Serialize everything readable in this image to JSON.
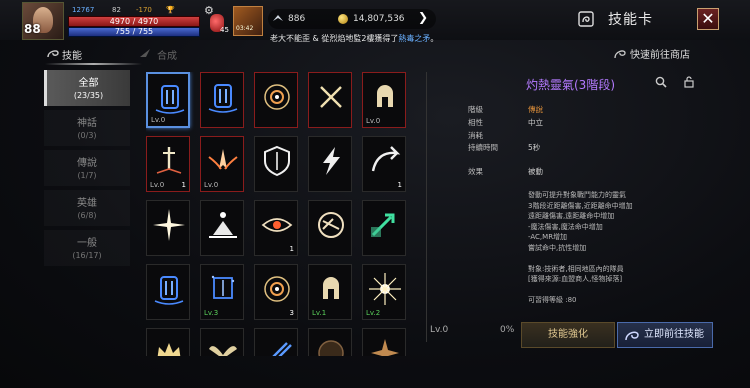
{
  "player": {
    "level": "88",
    "power": "12767",
    "stat2": "82",
    "stat3": "-170",
    "hp": "4970 / 4970",
    "mp": "755 / 755",
    "potion_count": "45",
    "buff_time": "03:42"
  },
  "currency": {
    "wings": "886",
    "gold": "14,807,536"
  },
  "window": {
    "title": "技能卡",
    "close": "✕",
    "icon": "skill-card-icon"
  },
  "marquee": {
    "text": "老大不能歪 & 從烈焰地監2樓獲得了",
    "item": "熱毒之矛",
    "end": "。"
  },
  "tabs": {
    "skill": "技能",
    "combine": "合成",
    "shop": "快速前往商店"
  },
  "categories": [
    {
      "name": "全部",
      "count": "(23/35)",
      "active": true
    },
    {
      "name": "神話",
      "count": "(0/3)"
    },
    {
      "name": "傳說",
      "count": "(1/7)"
    },
    {
      "name": "英雄",
      "count": "(6/8)"
    },
    {
      "name": "一般",
      "count": "(16/17)"
    }
  ],
  "grid": [
    {
      "icon": "blue-pillar-icon",
      "lv": "Lv.0",
      "num": "",
      "border": "sel"
    },
    {
      "icon": "blue-pillar-icon",
      "lv": "",
      "num": "",
      "border": "red"
    },
    {
      "icon": "target-icon",
      "lv": "",
      "num": "",
      "border": "red"
    },
    {
      "icon": "crossed-swords-icon",
      "lv": "",
      "num": "",
      "border": "red"
    },
    {
      "icon": "spartan-helmet-icon",
      "lv": "Lv.0",
      "num": "",
      "border": "red"
    },
    {
      "icon": "sword-ground-icon",
      "lv": "Lv.0",
      "num": "1",
      "border": "red"
    },
    {
      "icon": "winged-swords-icon",
      "lv": "Lv.0",
      "num": "",
      "border": "red"
    },
    {
      "icon": "shield-icon",
      "lv": "",
      "num": "",
      "border": ""
    },
    {
      "icon": "lightning-icon",
      "lv": "",
      "num": "",
      "border": ""
    },
    {
      "icon": "swoosh-icon",
      "lv": "",
      "num": "1",
      "border": ""
    },
    {
      "icon": "burst-icon",
      "lv": "",
      "num": "",
      "border": ""
    },
    {
      "icon": "fulcrum-icon",
      "lv": "",
      "num": "",
      "border": ""
    },
    {
      "icon": "eye-icon",
      "lv": "",
      "num": "1",
      "border": ""
    },
    {
      "icon": "claw-ring-icon",
      "lv": "",
      "num": "",
      "border": ""
    },
    {
      "icon": "green-arrow-icon",
      "lv": "",
      "num": "",
      "border": ""
    },
    {
      "icon": "blue-pillar-icon",
      "lv": "",
      "num": "",
      "border": ""
    },
    {
      "icon": "blue-rune-icon",
      "lv": "Lv.3",
      "num": "",
      "border": "",
      "lvgreen": true
    },
    {
      "icon": "target-icon",
      "lv": "",
      "num": "3",
      "border": ""
    },
    {
      "icon": "helmet-icon",
      "lv": "Lv.1",
      "num": "",
      "border": "",
      "lvgreen": true
    },
    {
      "icon": "flare-icon",
      "lv": "Lv.2",
      "num": "",
      "border": "",
      "lvgreen": true
    },
    {
      "icon": "crown-icon",
      "lv": "",
      "num": "",
      "border": ""
    },
    {
      "icon": "wings-icon",
      "lv": "",
      "num": "",
      "border": ""
    },
    {
      "icon": "blue-arrows-icon",
      "lv": "",
      "num": "",
      "border": ""
    },
    {
      "icon": "dark-orb-icon",
      "lv": "",
      "num": "",
      "border": ""
    },
    {
      "icon": "star-spike-icon",
      "lv": "",
      "num": "",
      "border": ""
    }
  ],
  "detail": {
    "title": "灼熱靈氣(3階段)",
    "rows": [
      {
        "label": "階級",
        "value": "傳說",
        "accent": true
      },
      {
        "label": "相性",
        "value": "中立"
      },
      {
        "label": "消耗",
        "value": ""
      },
      {
        "label": "持續時間",
        "value": "5秒"
      }
    ],
    "effect_label": "效果",
    "effect_value": "被動",
    "description": [
      "發動可提升對象戰鬥能力的靈氣",
      "3階段近距離傷害,近距離命中增加",
      "遠距離傷害,遠距離命中增加",
      "-魔法傷害,魔法命中增加",
      "-AC,MR增加",
      "嘗試命中,抗性增加",
      "",
      "對象:技術者,相同地區內的隊員",
      "[獲得來源:血盟商人,怪物掉落]",
      "",
      "可習得等級 :80"
    ],
    "level": "Lv.0",
    "percent": "0%",
    "enhance_button": "技能強化",
    "goto_button": "立即前往技能"
  },
  "colors": {
    "accent_purple": "#b47aff",
    "legend_orange": "#e0903a",
    "border_red": "#8a1c1c",
    "border_blue": "#3a70c0"
  }
}
